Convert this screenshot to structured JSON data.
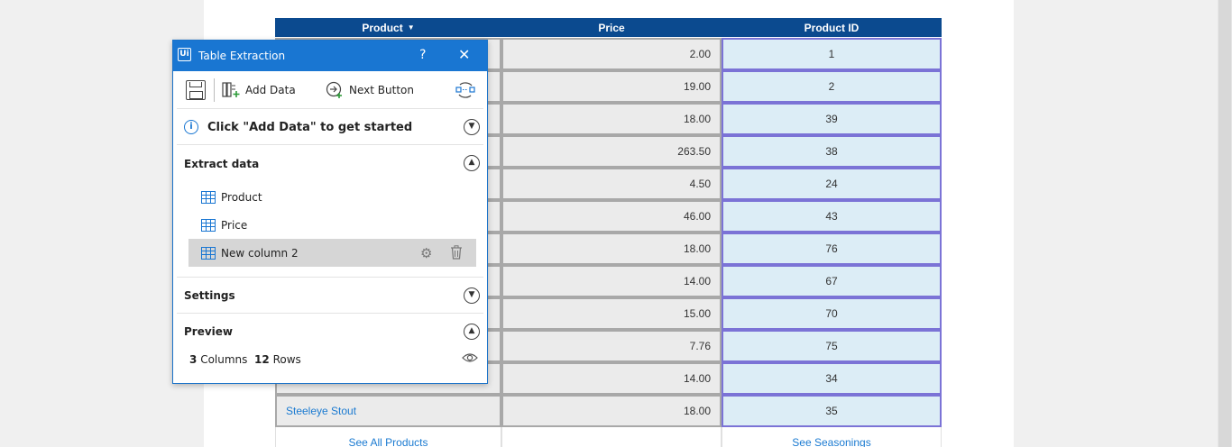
{
  "table": {
    "headers": {
      "product": "Product",
      "price": "Price",
      "product_id": "Product ID"
    },
    "rows": [
      {
        "product": "",
        "price": "2.00",
        "id": "1"
      },
      {
        "product": "",
        "price": "19.00",
        "id": "2"
      },
      {
        "product": "",
        "price": "18.00",
        "id": "39"
      },
      {
        "product": "",
        "price": "263.50",
        "id": "38"
      },
      {
        "product": "",
        "price": "4.50",
        "id": "24"
      },
      {
        "product": "",
        "price": "46.00",
        "id": "43"
      },
      {
        "product": "",
        "price": "18.00",
        "id": "76"
      },
      {
        "product": "",
        "price": "14.00",
        "id": "67"
      },
      {
        "product": "",
        "price": "15.00",
        "id": "70"
      },
      {
        "product": "",
        "price": "7.76",
        "id": "75"
      },
      {
        "product": "",
        "price": "14.00",
        "id": "34"
      },
      {
        "product": "Steeleye Stout",
        "price": "18.00",
        "id": "35"
      }
    ],
    "footer": {
      "left_link": "See All Products",
      "right_link": "See Seasonings"
    }
  },
  "panel": {
    "title": "Table Extraction",
    "logo": "Ui",
    "help": "?",
    "close": "✕",
    "toolbar": {
      "add_data": "Add Data",
      "next_button": "Next Button"
    },
    "info_message": "Click \"Add Data\" to get started",
    "extract_title": "Extract data",
    "columns": [
      "Product",
      "Price",
      "New column 2"
    ],
    "settings_title": "Settings",
    "preview_title": "Preview",
    "preview": {
      "columns_count": "3",
      "columns_label": "Columns",
      "rows_count": "12",
      "rows_label": "Rows"
    }
  },
  "colors": {
    "header_blue": "#0b4a8f",
    "panel_blue": "#1976d2",
    "link_blue": "#1a7ad1",
    "selection_border": "#7b73d6"
  }
}
